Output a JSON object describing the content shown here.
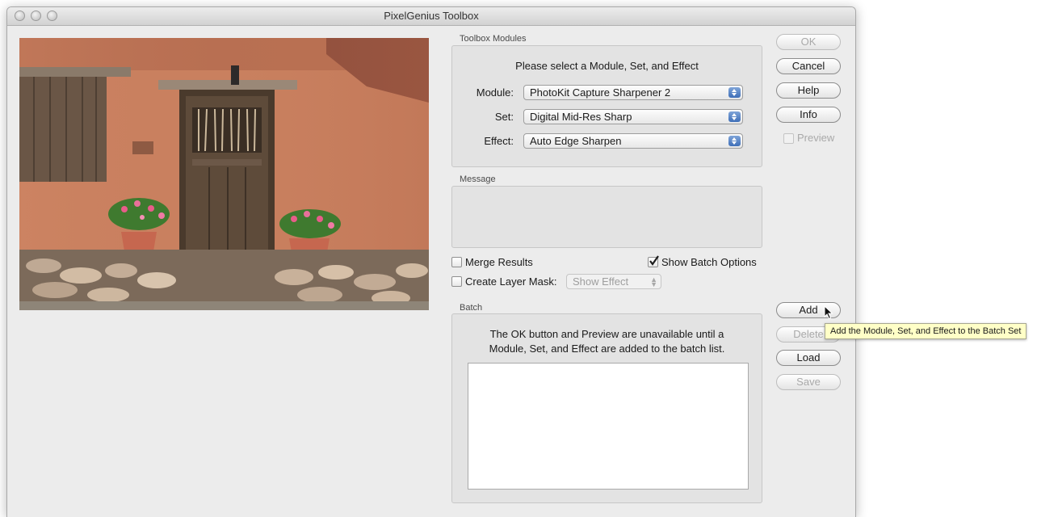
{
  "window": {
    "title": "PixelGenius Toolbox"
  },
  "modules": {
    "group_label": "Toolbox Modules",
    "prompt": "Please select a Module, Set, and Effect",
    "module_label": "Module:",
    "module_value": "PhotoKit Capture Sharpener 2",
    "set_label": "Set:",
    "set_value": "Digital Mid-Res Sharp",
    "effect_label": "Effect:",
    "effect_value": "Auto Edge Sharpen"
  },
  "message": {
    "group_label": "Message"
  },
  "options": {
    "merge_results": "Merge Results",
    "show_batch_options": "Show Batch Options",
    "create_layer_mask": "Create Layer Mask:",
    "layer_mask_value": "Show Effect"
  },
  "batch": {
    "group_label": "Batch",
    "info_line1": "The OK button and Preview are unavailable until a",
    "info_line2": "Module, Set, and Effect are added to the batch list."
  },
  "buttons": {
    "ok": "OK",
    "cancel": "Cancel",
    "help": "Help",
    "info": "Info",
    "preview": "Preview",
    "add": "Add",
    "delete": "Delete",
    "load": "Load",
    "save": "Save"
  },
  "tooltip": {
    "text": "Add the Module, Set, and Effect to the Batch Set"
  }
}
